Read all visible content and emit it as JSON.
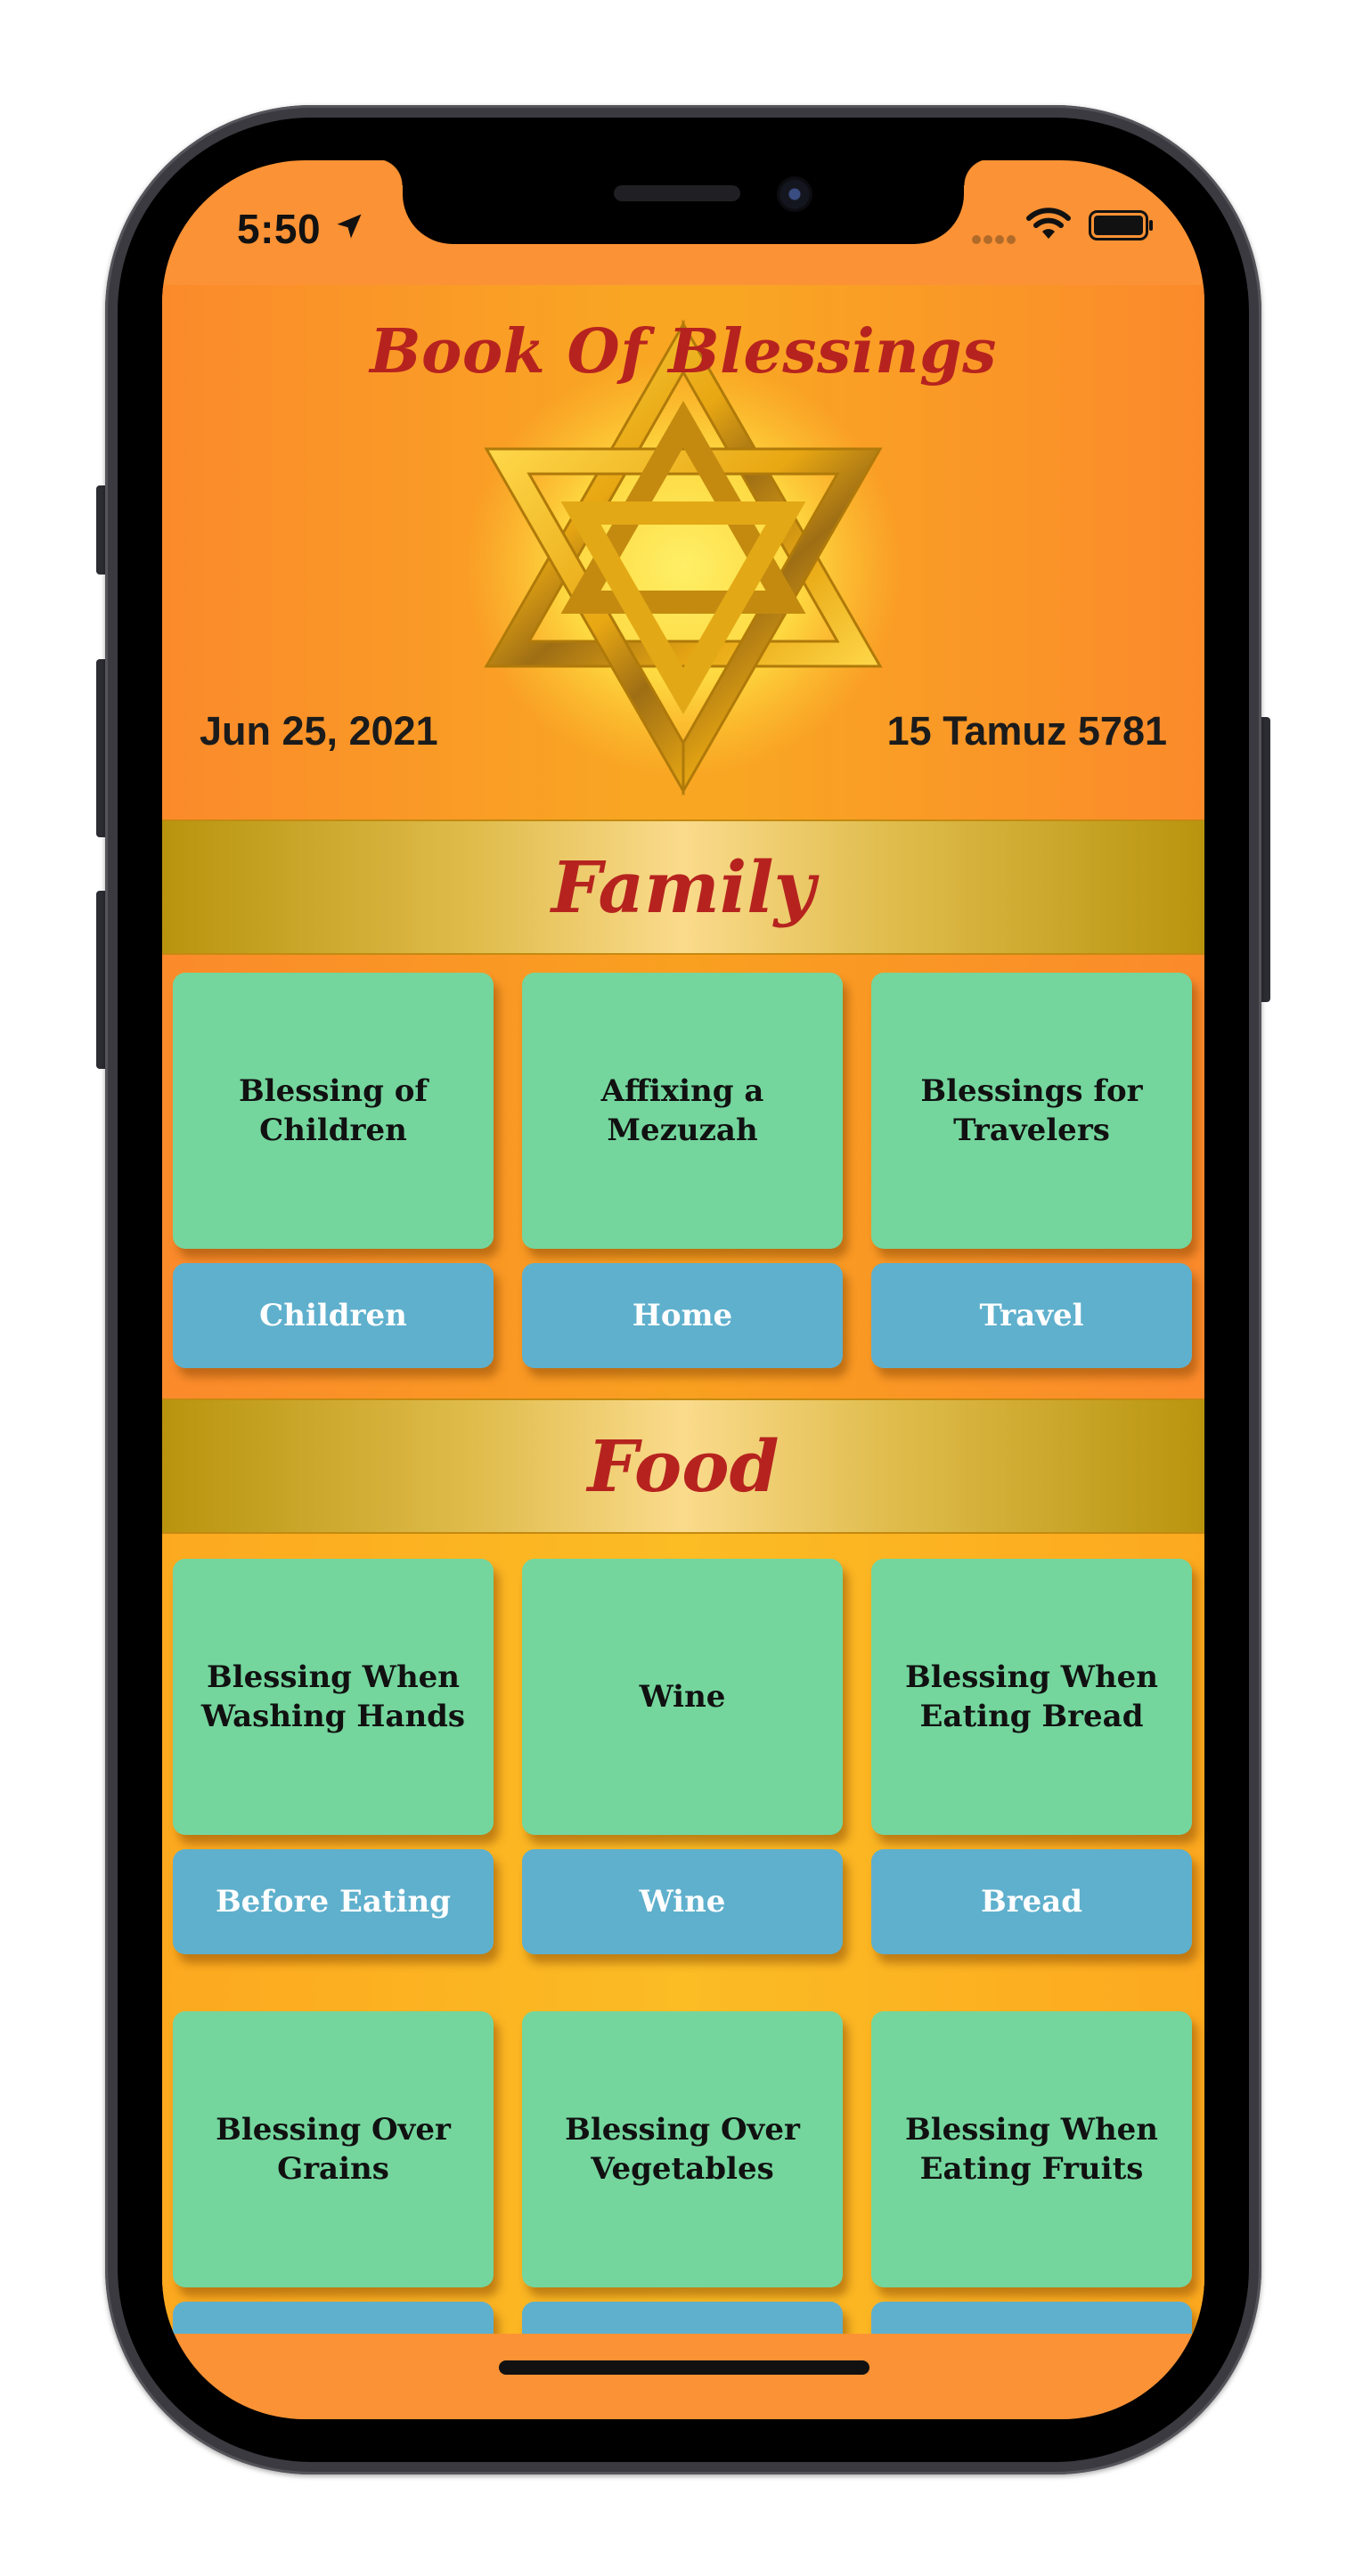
{
  "status_bar": {
    "time": "5:50",
    "icons": [
      "location-arrow-icon",
      "cellular-dots-icon",
      "wifi-icon",
      "battery-icon"
    ]
  },
  "header": {
    "title": "Book Of Blessings",
    "gregorian_date": "Jun 25, 2021",
    "hebrew_date": "15 Tamuz 5781",
    "emblem": "star-of-david-icon"
  },
  "sections": [
    {
      "title": "Family",
      "rows": [
        [
          {
            "blessing": "Blessing of Children",
            "category": "Children"
          },
          {
            "blessing": "Affixing a Mezuzah",
            "category": "Home"
          },
          {
            "blessing": "Blessings for Travelers",
            "category": "Travel"
          }
        ]
      ]
    },
    {
      "title": "Food",
      "rows": [
        [
          {
            "blessing": "Blessing When Washing Hands",
            "category": "Before Eating"
          },
          {
            "blessing": "Wine",
            "category": "Wine"
          },
          {
            "blessing": "Blessing When Eating Bread",
            "category": "Bread"
          }
        ],
        [
          {
            "blessing": "Blessing Over Grains",
            "category": ""
          },
          {
            "blessing": "Blessing Over Vegetables",
            "category": ""
          },
          {
            "blessing": "Blessing When Eating Fruits",
            "category": ""
          }
        ]
      ]
    }
  ],
  "colors": {
    "background_orange": "#fb9235",
    "title_red": "#b6231f",
    "tile_green": "#74d69d",
    "category_blue": "#5fb0cd",
    "band_gold": "#e0bc4c"
  }
}
